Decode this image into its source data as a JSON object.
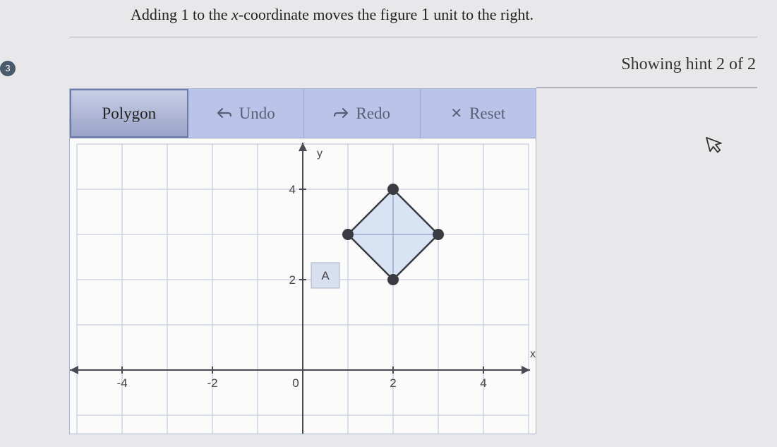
{
  "hint": {
    "prefix": "Adding 1 to the ",
    "xvar": "x",
    "middle": "-coordinate moves the figure ",
    "num": "1",
    "suffix": " unit to the right."
  },
  "hint_status": "Showing hint 2 of 2",
  "step_number": "3",
  "toolbar": {
    "polygon": "Polygon",
    "undo": "Undo",
    "redo": "Redo",
    "reset": "Reset"
  },
  "graph": {
    "x_label": "x",
    "y_label": "y",
    "shape_label": "A",
    "x_ticks": [
      "-4",
      "-2",
      "0",
      "2",
      "4"
    ],
    "y_ticks": [
      "2",
      "4"
    ]
  },
  "chart_data": {
    "type": "scatter",
    "title": "",
    "xlabel": "x",
    "ylabel": "y",
    "xlim": [
      -5,
      5
    ],
    "ylim": [
      -1,
      5
    ],
    "series": [
      {
        "name": "A",
        "shape": "polygon",
        "points": [
          {
            "x": 1,
            "y": 3
          },
          {
            "x": 2,
            "y": 4
          },
          {
            "x": 3,
            "y": 3
          },
          {
            "x": 2,
            "y": 2
          }
        ]
      }
    ]
  }
}
